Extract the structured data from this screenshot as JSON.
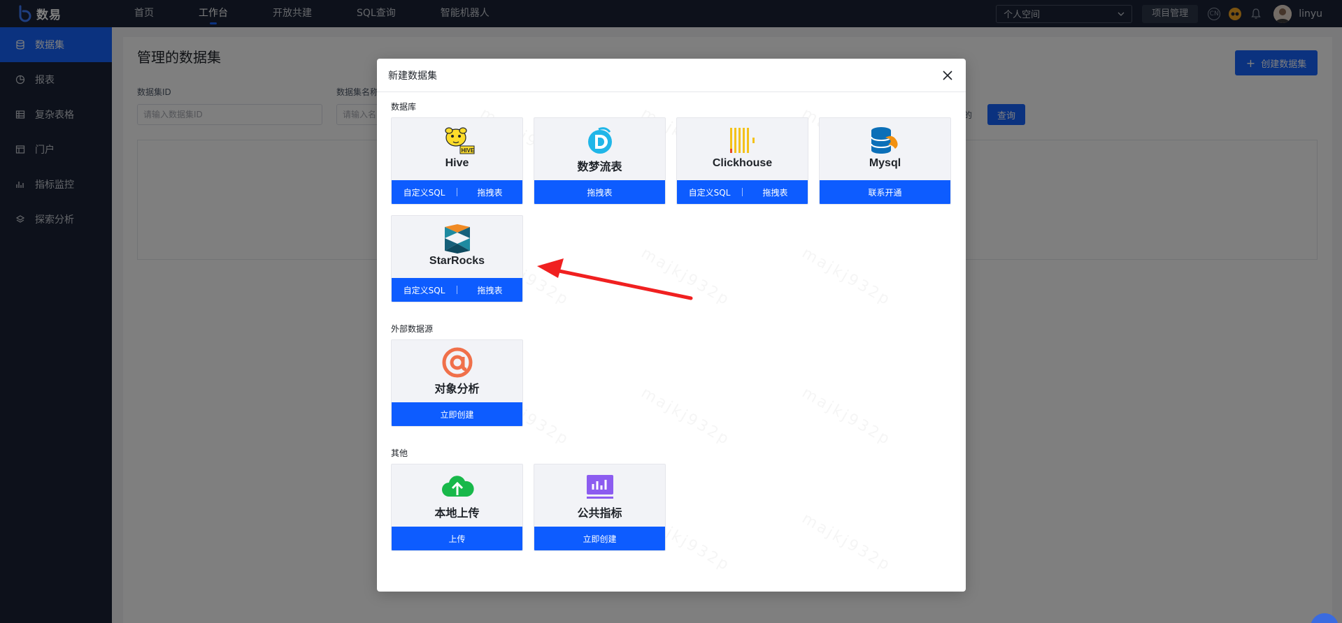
{
  "app": {
    "name": "数易"
  },
  "nav": [
    "首页",
    "工作台",
    "开放共建",
    "SQL查询",
    "智能机器人"
  ],
  "topbar": {
    "space_select": "个人空间",
    "project_btn": "项目管理",
    "username": "linyu",
    "lang_badge": "CN"
  },
  "sidebar": [
    {
      "label": "数据集",
      "icon": "database-icon"
    },
    {
      "label": "报表",
      "icon": "pie-chart-icon"
    },
    {
      "label": "复杂表格",
      "icon": "table-icon"
    },
    {
      "label": "门户",
      "icon": "layout-icon"
    },
    {
      "label": "指标监控",
      "icon": "bar-chart-icon"
    },
    {
      "label": "探索分析",
      "icon": "explore-icon"
    }
  ],
  "page": {
    "title": "管理的数据集",
    "create_btn": "创建数据集",
    "filter_id_label": "数据集ID",
    "filter_id_placeholder": "请输入数据集ID",
    "filter_name_label": "数据集名称",
    "filter_name_placeholder": "请输入名",
    "side_text": "的",
    "query_btn": "查询"
  },
  "modal": {
    "title": "新建数据集",
    "sections": {
      "database": "数据库",
      "external": "外部数据源",
      "other": "其他"
    },
    "cards": {
      "hive": {
        "name": "Hive",
        "actions": [
          "自定义SQL",
          "拖拽表"
        ]
      },
      "shumeng": {
        "name": "数梦流表",
        "actions": [
          "拖拽表"
        ]
      },
      "clickhouse": {
        "name": "Clickhouse",
        "actions": [
          "自定义SQL",
          "拖拽表"
        ]
      },
      "mysql": {
        "name": "Mysql",
        "actions": [
          "联系开通"
        ]
      },
      "starrocks": {
        "name": "StarRocks",
        "actions": [
          "自定义SQL",
          "拖拽表"
        ]
      },
      "object": {
        "name": "对象分析",
        "actions": [
          "立即创建"
        ]
      },
      "upload": {
        "name": "本地上传",
        "actions": [
          "上传"
        ]
      },
      "metric": {
        "name": "公共指标",
        "actions": [
          "立即创建"
        ]
      }
    },
    "watermark": "majkj932p"
  },
  "colors": {
    "primary": "#1664ff",
    "card_action": "#0d5cff",
    "topbar": "#1a2336",
    "arrow": "#f02020"
  }
}
